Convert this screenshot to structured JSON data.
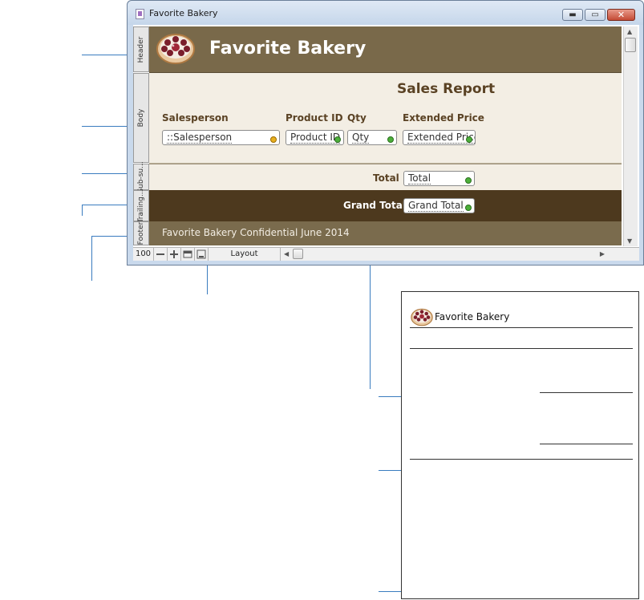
{
  "window": {
    "title": "Favorite Bakery",
    "minimize_glyph": "▬",
    "maximize_glyph": "▭",
    "close_glyph": "✕"
  },
  "parts": {
    "header": "Header",
    "body": "Body",
    "subsummary": "Sub-su...",
    "trailing": "Trailing...",
    "footer": "Footer"
  },
  "layout": {
    "company_name": "Favorite Bakery",
    "report_title": "Sales Report",
    "columns": [
      {
        "label": "Salesperson",
        "field": "::Salesperson"
      },
      {
        "label": "Product ID",
        "field": "Product ID"
      },
      {
        "label": "Qty",
        "field": "Qty"
      },
      {
        "label": "Extended Price",
        "field": "Extended Price"
      }
    ],
    "total_label": "Total",
    "total_field": "Total",
    "grand_total_label": "Grand Total",
    "grand_total_field": "Grand Total",
    "footer_text": "Favorite Bakery Confidential June 2014"
  },
  "statusbar": {
    "zoom": "100",
    "mode": "Layout"
  },
  "printed_page": {
    "company_name": "Favorite Bakery"
  },
  "colors": {
    "header_band": "#79694a",
    "body_band": "#f3eee4",
    "trailing_band": "#4d391e",
    "footer_band": "#7a6b4d",
    "callout_line": "#3a7cbf"
  }
}
